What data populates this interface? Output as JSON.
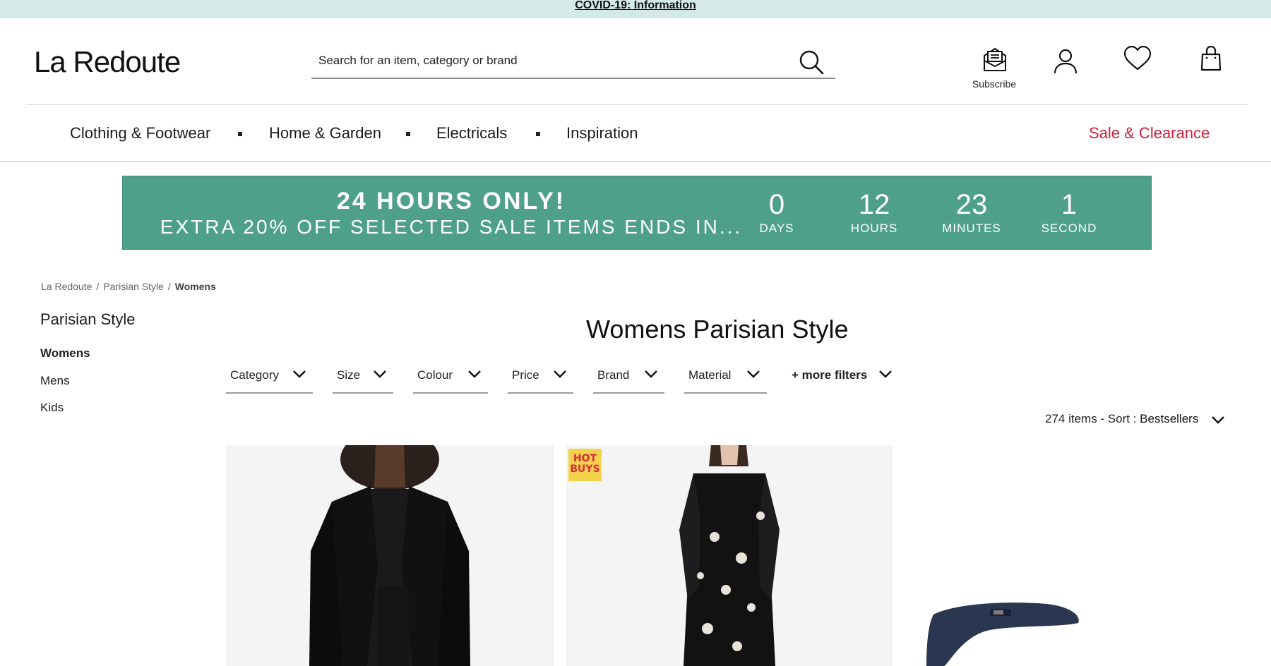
{
  "topbar": {
    "link": "COVID-19: Information"
  },
  "header": {
    "logo": "La Redoute",
    "search_placeholder": "Search for an item, category or brand",
    "subscribe_label": "Subscribe",
    "icons": [
      "subscribe-icon",
      "account-icon",
      "wishlist-icon",
      "bag-icon"
    ]
  },
  "nav": {
    "items": [
      "Clothing & Footwear",
      "Home & Garden",
      "Electricals",
      "Inspiration"
    ],
    "sale": "Sale & Clearance",
    "sale_color": "#cf1f3a"
  },
  "promo": {
    "line1": "24 HOURS ONLY!",
    "line2": "EXTRA 20% OFF SELECTED SALE ITEMS ENDS IN...",
    "bg_color": "#4fa08b",
    "countdown": [
      {
        "value": "0",
        "unit": "DAYS"
      },
      {
        "value": "12",
        "unit": "HOURS"
      },
      {
        "value": "23",
        "unit": "MINUTES"
      },
      {
        "value": "1",
        "unit": "SECOND"
      }
    ]
  },
  "breadcrumb": [
    "La Redoute",
    "Parisian Style",
    "Womens"
  ],
  "sidebar": {
    "title": "Parisian Style",
    "links": [
      "Womens",
      "Mens",
      "Kids"
    ],
    "active": "Womens"
  },
  "main": {
    "title": "Womens Parisian Style",
    "filters": [
      "Category",
      "Size",
      "Colour",
      "Price",
      "Brand",
      "Material",
      "+ more filters"
    ],
    "item_count": "274 items",
    "sort_prefix": " - Sort : ",
    "sort_value": "Bestsellers"
  },
  "products": [
    {
      "image": "black-blazer-photo"
    },
    {
      "image": "floral-dress-photo",
      "badge": "HOT BUYS"
    },
    {
      "image": "navy-ankle-strap-shoe-photo"
    }
  ]
}
